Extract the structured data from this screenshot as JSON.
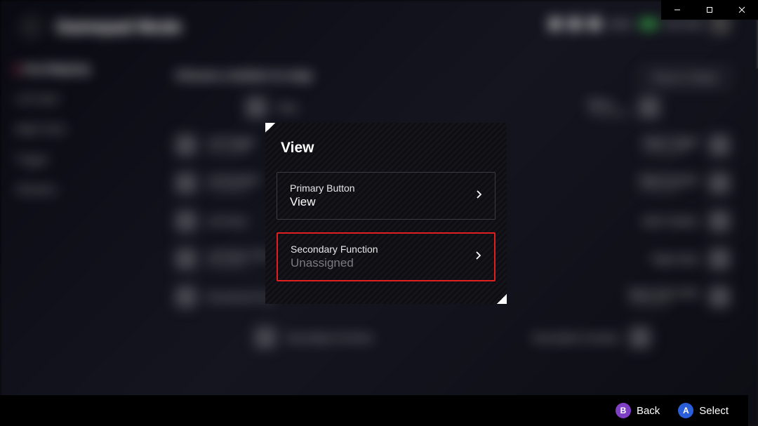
{
  "windowControls": {
    "min": "min",
    "max": "max",
    "close": "close"
  },
  "header": {
    "title": "Gamepad Mode",
    "batteryPct": "100%",
    "time": "06:17PM"
  },
  "sidebar": {
    "items": [
      {
        "label": "Key Mapping",
        "active": true
      },
      {
        "label": "Left Stick"
      },
      {
        "label": "Right Stick"
      },
      {
        "label": "Trigger"
      },
      {
        "label": "Vibration"
      }
    ]
  },
  "main": {
    "heading": "Choose a button to map",
    "resetLabel": "Reset to Default",
    "leftItems": [
      {
        "label": "View",
        "sub": ""
      },
      {
        "label": "Left Trigger",
        "sub": "Unassigned"
      },
      {
        "label": "Left Bumper",
        "sub": "Unassigned"
      },
      {
        "label": "Left Stick",
        "sub": ""
      },
      {
        "label": "Left Stick Click",
        "sub": "Unassigned"
      },
      {
        "label": "Directional Pad",
        "sub": ""
      }
    ],
    "rightItems": [
      {
        "label": "Menu",
        "sub": "Unassigned"
      },
      {
        "label": "Right Trigger",
        "sub": "Unassigned"
      },
      {
        "label": "Right Bumper",
        "sub": "Unassigned"
      },
      {
        "label": "ABXY Button",
        "sub": ""
      },
      {
        "label": "Right Stick",
        "sub": ""
      },
      {
        "label": "Right Stick Click",
        "sub": "Unassigned"
      }
    ],
    "secondaryLeft": "Secondary Function",
    "secondaryRight": "Secondary Function"
  },
  "modal": {
    "title": "View",
    "primary": {
      "label": "Primary Button",
      "value": "View"
    },
    "secondary": {
      "label": "Secondary Function",
      "value": "Unassigned"
    }
  },
  "footer": {
    "bGlyph": "B",
    "back": "Back",
    "aGlyph": "A",
    "select": "Select"
  }
}
